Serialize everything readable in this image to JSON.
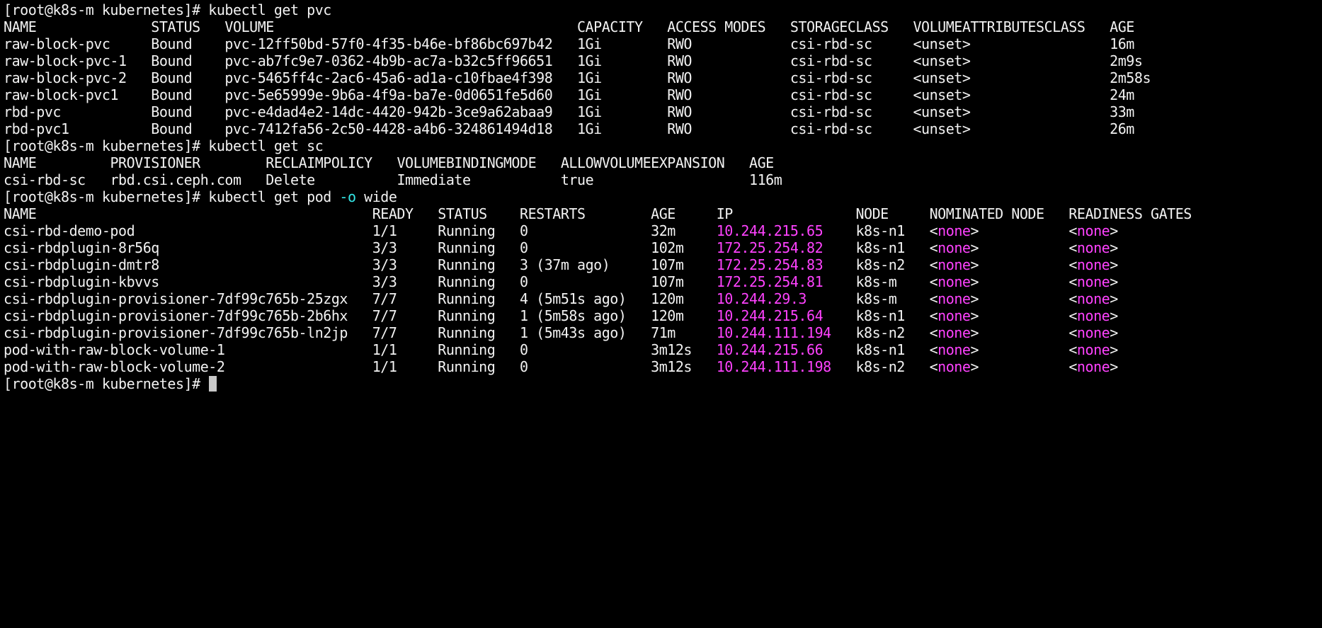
{
  "prompt": "[root@k8s-m kubernetes]# ",
  "pvc": {
    "command": "kubectl get pvc",
    "headers": [
      "NAME",
      "STATUS",
      "VOLUME",
      "CAPACITY",
      "ACCESS MODES",
      "STORAGECLASS",
      "VOLUMEATTRIBUTESCLASS",
      "AGE"
    ],
    "rows": [
      [
        "raw-block-pvc",
        "Bound",
        "pvc-12ff50bd-57f0-4f35-b46e-bf86bc697b42",
        "1Gi",
        "RWO",
        "csi-rbd-sc",
        "<unset>",
        "16m"
      ],
      [
        "raw-block-pvc-1",
        "Bound",
        "pvc-ab7fc9e7-0362-4b9b-ac7a-b32c5ff96651",
        "1Gi",
        "RWO",
        "csi-rbd-sc",
        "<unset>",
        "2m9s"
      ],
      [
        "raw-block-pvc-2",
        "Bound",
        "pvc-5465ff4c-2ac6-45a6-ad1a-c10fbae4f398",
        "1Gi",
        "RWO",
        "csi-rbd-sc",
        "<unset>",
        "2m58s"
      ],
      [
        "raw-block-pvc1",
        "Bound",
        "pvc-5e65999e-9b6a-4f9a-ba7e-0d0651fe5d60",
        "1Gi",
        "RWO",
        "csi-rbd-sc",
        "<unset>",
        "24m"
      ],
      [
        "rbd-pvc",
        "Bound",
        "pvc-e4dad4e2-14dc-4420-942b-3ce9a62abaa9",
        "1Gi",
        "RWO",
        "csi-rbd-sc",
        "<unset>",
        "33m"
      ],
      [
        "rbd-pvc1",
        "Bound",
        "pvc-7412fa56-2c50-4428-a4b6-324861494d18",
        "1Gi",
        "RWO",
        "csi-rbd-sc",
        "<unset>",
        "26m"
      ]
    ]
  },
  "sc": {
    "command": "kubectl get sc",
    "headers": [
      "NAME",
      "PROVISIONER",
      "RECLAIMPOLICY",
      "VOLUMEBINDINGMODE",
      "ALLOWVOLUMEEXPANSION",
      "AGE"
    ],
    "rows": [
      [
        "csi-rbd-sc",
        "rbd.csi.ceph.com",
        "Delete",
        "Immediate",
        "true",
        "116m"
      ]
    ]
  },
  "pod": {
    "command_pre": "kubectl get pod ",
    "command_flag": "-o",
    "command_post": " wide",
    "headers": [
      "NAME",
      "READY",
      "STATUS",
      "RESTARTS",
      "AGE",
      "IP",
      "NODE",
      "NOMINATED NODE",
      "READINESS GATES"
    ],
    "rows": [
      [
        "csi-rbd-demo-pod",
        "1/1",
        "Running",
        "0",
        "32m",
        "10.244.215.65",
        "k8s-n1",
        "none",
        "none"
      ],
      [
        "csi-rbdplugin-8r56q",
        "3/3",
        "Running",
        "0",
        "102m",
        "172.25.254.82",
        "k8s-n1",
        "none",
        "none"
      ],
      [
        "csi-rbdplugin-dmtr8",
        "3/3",
        "Running",
        "3 (37m ago)",
        "107m",
        "172.25.254.83",
        "k8s-n2",
        "none",
        "none"
      ],
      [
        "csi-rbdplugin-kbvvs",
        "3/3",
        "Running",
        "0",
        "107m",
        "172.25.254.81",
        "k8s-m",
        "none",
        "none"
      ],
      [
        "csi-rbdplugin-provisioner-7df99c765b-25zgx",
        "7/7",
        "Running",
        "4 (5m51s ago)",
        "120m",
        "10.244.29.3",
        "k8s-m",
        "none",
        "none"
      ],
      [
        "csi-rbdplugin-provisioner-7df99c765b-2b6hx",
        "7/7",
        "Running",
        "1 (5m58s ago)",
        "120m",
        "10.244.215.64",
        "k8s-n1",
        "none",
        "none"
      ],
      [
        "csi-rbdplugin-provisioner-7df99c765b-ln2jp",
        "7/7",
        "Running",
        "1 (5m43s ago)",
        "71m",
        "10.244.111.194",
        "k8s-n2",
        "none",
        "none"
      ],
      [
        "pod-with-raw-block-volume-1",
        "1/1",
        "Running",
        "0",
        "3m12s",
        "10.244.215.66",
        "k8s-n1",
        "none",
        "none"
      ],
      [
        "pod-with-raw-block-volume-2",
        "1/1",
        "Running",
        "0",
        "3m12s",
        "10.244.111.198",
        "k8s-n2",
        "none",
        "none"
      ]
    ]
  },
  "colors": {
    "background": "#000000",
    "foreground": "#f2f2f2",
    "ip": "#ff42ff",
    "flag": "#33e6e6"
  }
}
